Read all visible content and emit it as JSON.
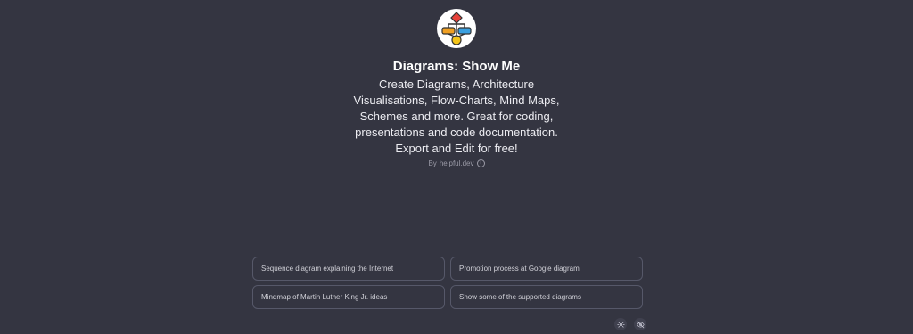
{
  "gpt": {
    "logo_icon": "flowchart-logo-icon",
    "title": "Diagrams: Show Me",
    "description": "Create Diagrams, Architecture Visualisations, Flow-Charts, Mind Maps, Schemes and more. Great for coding, presentations and code documentation. Export and Edit for free!",
    "by_prefix": "By",
    "author": "helpful.dev",
    "info_icon": "info-icon"
  },
  "suggestions": [
    {
      "label": "Sequence diagram explaining the Internet"
    },
    {
      "label": "Promotion process at Google diagram"
    },
    {
      "label": "Mindmap of Martin Luther King Jr. ideas"
    },
    {
      "label": "Show some of the supported diagrams"
    }
  ],
  "corner_buttons": [
    {
      "icon": "gear-icon"
    },
    {
      "icon": "eye-off-icon"
    }
  ],
  "colors": {
    "background": "#343541",
    "card_border": "#565869",
    "logo_red": "#e8413a",
    "logo_orange": "#f0a023",
    "logo_blue": "#3aa0e0",
    "logo_yellow": "#f5c518"
  }
}
